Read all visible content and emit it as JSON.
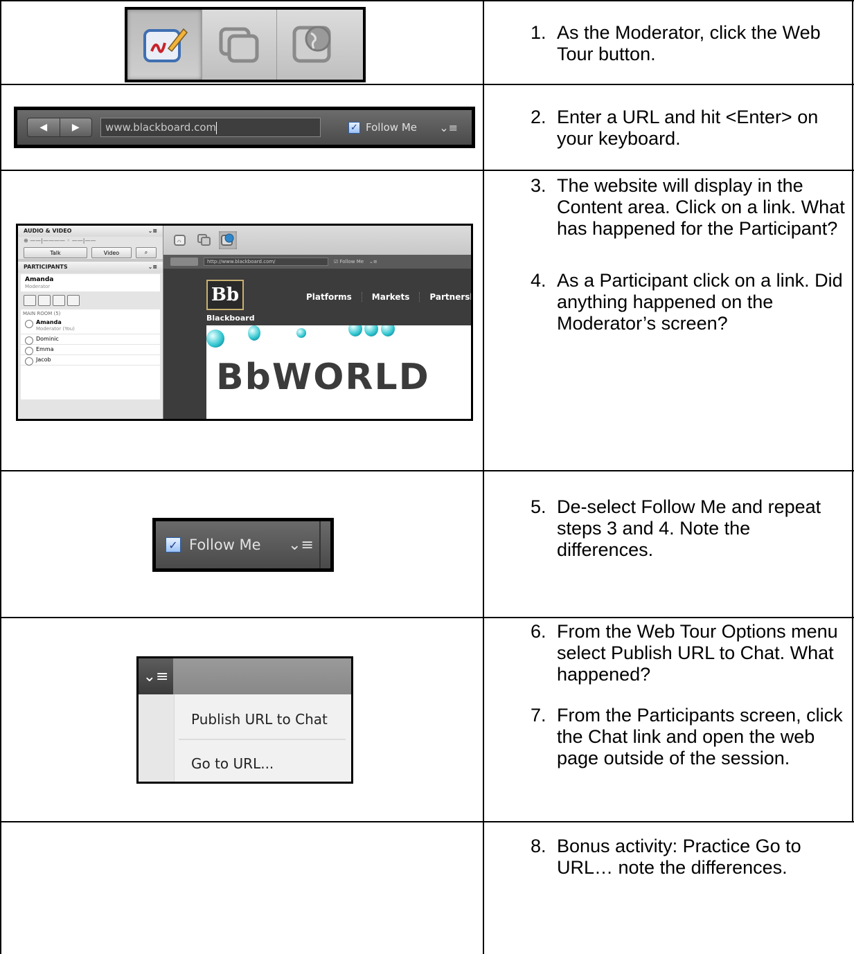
{
  "steps": [
    {
      "num": "1.",
      "text": "As the Moderator, click the Web Tour button."
    },
    {
      "num": "2.",
      "text": "Enter a URL and hit <Enter> on your keyboard."
    },
    {
      "num": "3.",
      "text": "The website will display in the Content area.  Click on a link. What has happened for the Participant?"
    },
    {
      "num": "4.",
      "text": "As a Participant click on a link. Did anything happened on the Moderator’s screen?"
    },
    {
      "num": "5.",
      "text": "De-select Follow Me and repeat steps 3 and 4.  Note the differences."
    },
    {
      "num": "6.",
      "text": "From the Web Tour Options menu select Publish URL to Chat.  What happened?"
    },
    {
      "num": "7.",
      "text": "From the Participants screen, click the Chat link and open the web page outside of the session."
    },
    {
      "num": "8.",
      "text": "Bonus activity: Practice Go to URL… note the differences."
    }
  ],
  "url_bar": {
    "url": "www.blackboard.com",
    "follow_me": "Follow Me"
  },
  "session": {
    "audio_video": "AUDIO & VIDEO",
    "talk": "Talk",
    "video": "Video",
    "participants": "PARTICIPANTS",
    "moderator_name": "Amanda",
    "moderator_role": "Moderator",
    "main_room": "MAIN ROOM (5)",
    "you_role": "Moderator (You)",
    "people": [
      "Amanda",
      "Dominic",
      "Emma",
      "Jacob"
    ],
    "url": "http://www.blackboard.com/",
    "follow_me": "Follow Me",
    "logo": "Bb",
    "brand": "Blackboard",
    "nav": [
      "Platforms",
      "Markets",
      "Partnerships"
    ],
    "banner": "BbWORLD"
  },
  "follow_zoom": {
    "label": "Follow Me"
  },
  "options_menu": {
    "items": [
      "Publish URL to Chat",
      "Go to URL..."
    ]
  },
  "colors": {
    "highlight_blue": "#2b5fa8",
    "accent_teal": "#2bc3cd"
  }
}
